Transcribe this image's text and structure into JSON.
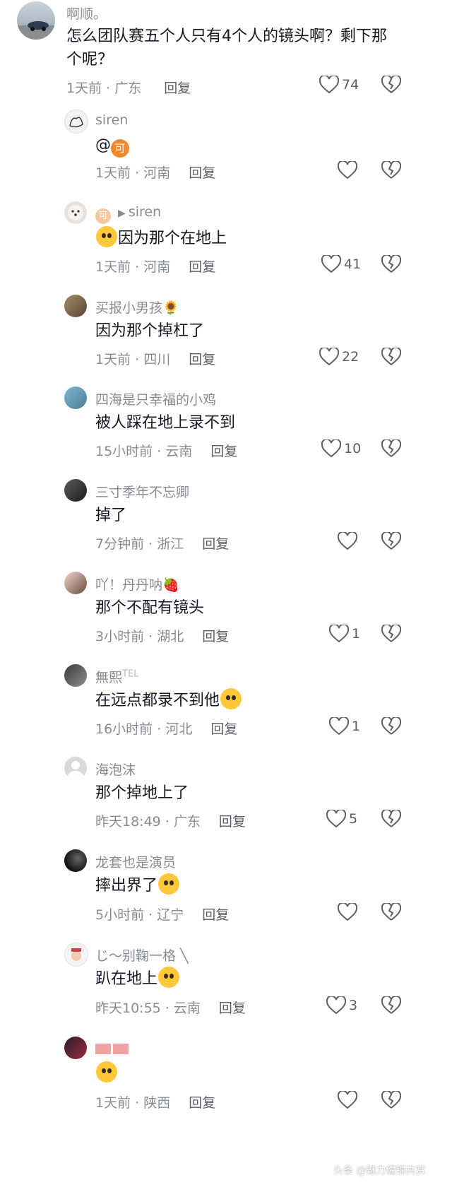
{
  "main_comment": {
    "username": "啊顺。",
    "text": "怎么团队赛五个人只有4个人的镜头啊？剩下那个呢？",
    "time": "1天前",
    "location": "广东",
    "reply_label": "回复",
    "likes": "74"
  },
  "replies": [
    {
      "username": "siren",
      "text_prefix": "@",
      "at_chip": "可",
      "text": "",
      "time": "1天前",
      "location": "河南",
      "reply_label": "回复",
      "likes": ""
    },
    {
      "username_prefix": "可",
      "arrow": "▶",
      "username": "siren",
      "text": "因为那个在地上",
      "time": "1天前",
      "location": "河南",
      "reply_label": "回复",
      "likes": "41"
    },
    {
      "username": "买报小男孩🌻",
      "text": "因为那个掉杠了",
      "time": "1天前",
      "location": "四川",
      "reply_label": "回复",
      "likes": "22"
    },
    {
      "username": "四海是只幸福的小鸡",
      "text": "被人踩在地上录不到",
      "time": "15小时前",
      "location": "云南",
      "reply_label": "回复",
      "likes": "10"
    },
    {
      "username": "三寸季年不忘卿",
      "text": "掉了",
      "time": "7分钟前",
      "location": "浙江",
      "reply_label": "回复",
      "likes": ""
    },
    {
      "username": "吖！丹丹呐🍓",
      "text": "那个不配有镜头",
      "time": "3小时前",
      "location": "湖北",
      "reply_label": "回复",
      "likes": "1"
    },
    {
      "username": "無熙",
      "username_badge": "TEL",
      "text": "在远点都录不到他",
      "time": "16小时前",
      "location": "河北",
      "reply_label": "回复",
      "likes": "1"
    },
    {
      "username": "海泡沫",
      "text": "那个掉地上了",
      "time": "昨天18:49",
      "location": "广东",
      "reply_label": "回复",
      "likes": "5"
    },
    {
      "username": "龙套也是演员",
      "text": "摔出界了",
      "time": "5小时前",
      "location": "辽宁",
      "reply_label": "回复",
      "likes": ""
    },
    {
      "username": "じ～别鞠一格 ╲",
      "text": "趴在地上",
      "time": "昨天10:55",
      "location": "云南",
      "reply_label": "回复",
      "likes": "3"
    },
    {
      "username": "",
      "text": "",
      "time": "1天前",
      "location": "陕西",
      "reply_label": "回复",
      "likes": ""
    }
  ],
  "watermark": "头条 @魅力健锦共赏",
  "colors": {
    "text": "#161823",
    "secondary": "#8a8b91",
    "icon": "#5d5e66",
    "emoji": "#ffc83a",
    "at_chip": "#f0882d"
  }
}
